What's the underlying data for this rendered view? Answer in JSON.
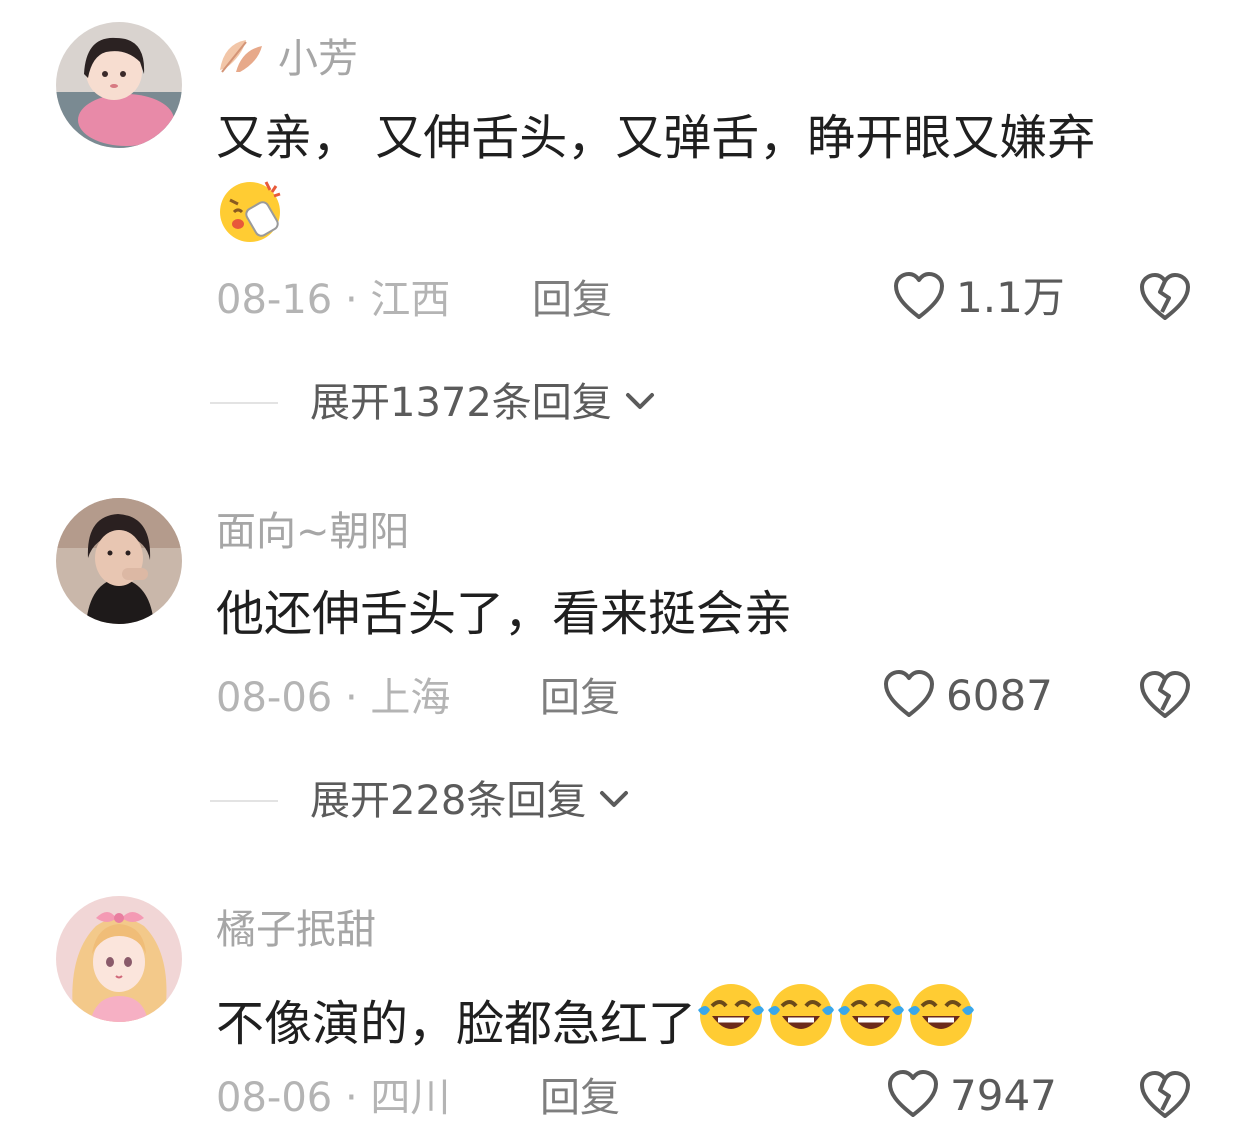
{
  "comments": [
    {
      "username": "小芳",
      "text": "又亲， 又伸舌头，又弹舌，睁开眼又嫌弃",
      "date_location": "08-16 · 江西",
      "reply_label": "回复",
      "like_count": "1.1万",
      "expand_label": "展开1372条回复",
      "emoji": "kissing-shocked-face"
    },
    {
      "username": "面向~朝阳",
      "text": "他还伸舌头了，看来挺会亲",
      "date_location": "08-06 · 上海",
      "reply_label": "回复",
      "like_count": "6087",
      "expand_label": "展开228条回复"
    },
    {
      "username": "橘子抿甜",
      "text": "不像演的，脸都急红了",
      "date_location": "08-06 · 四川",
      "reply_label": "回复",
      "like_count": "7947",
      "emoji": "crying-laughing-face"
    }
  ],
  "icons": {
    "like": "heart-outline-icon",
    "dislike": "broken-heart-icon",
    "expand": "chevron-down-icon"
  },
  "colors": {
    "username": "#a6a6a6",
    "text": "#1f1f1f",
    "meta": "#b4b4b4",
    "icon": "#5a5a5a",
    "emoji_yellow": "#ffcc33",
    "tear_blue": "#3aa7ea"
  }
}
